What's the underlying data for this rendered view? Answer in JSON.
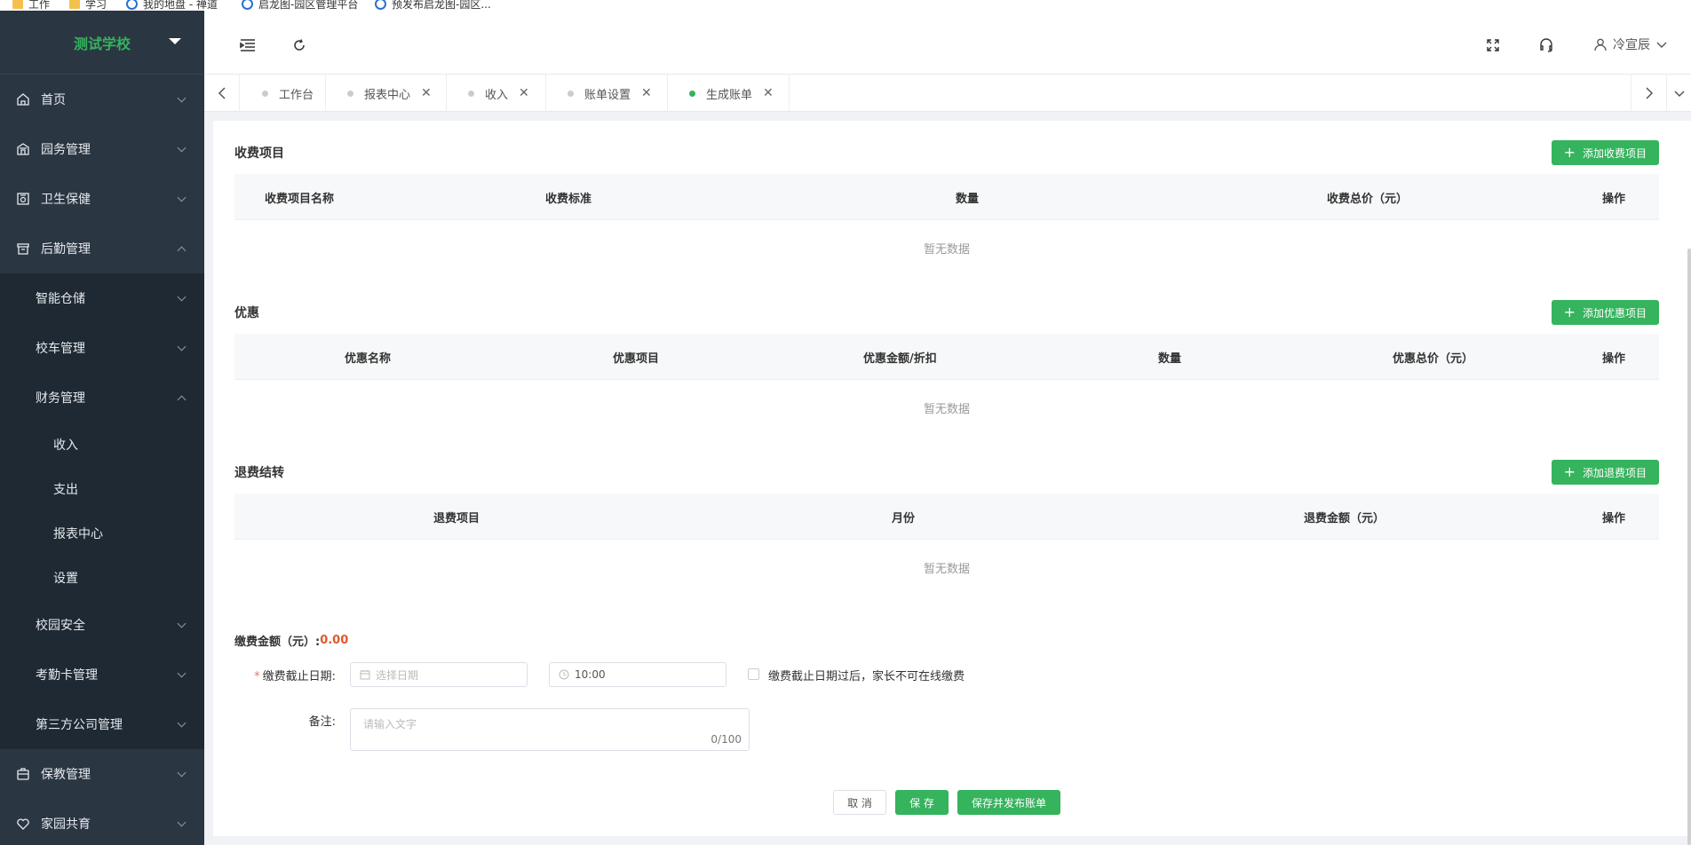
{
  "bookmarks": [
    {
      "label": "工作",
      "icon": "folder-icon"
    },
    {
      "label": "学习",
      "icon": "folder-icon"
    },
    {
      "label": "我的地盘 - 禅道",
      "icon": "site-icon"
    },
    {
      "label": "启龙图-园区管理平台",
      "icon": "site-icon"
    },
    {
      "label": "预发布启龙图-园区...",
      "icon": "site-icon"
    }
  ],
  "sidebar": {
    "school": "测试学校",
    "items": [
      {
        "label": "首页",
        "icon": "home-icon"
      },
      {
        "label": "园务管理",
        "icon": "building-icon"
      },
      {
        "label": "卫生保健",
        "icon": "health-icon"
      },
      {
        "label": "后勤管理",
        "icon": "logistics-icon"
      }
    ],
    "logistics_sub": [
      "智能仓储",
      "校车管理",
      "财务管理"
    ],
    "finance_sub": [
      "收入",
      "支出",
      "报表中心",
      "设置"
    ],
    "logistics_sub_more": [
      "校园安全",
      "考勤卡管理",
      "第三方公司管理"
    ],
    "items_bottom": [
      {
        "label": "保教管理",
        "icon": "education-icon"
      },
      {
        "label": "家园共育",
        "icon": "heart-icon"
      }
    ]
  },
  "topbar": {
    "user": "冷宣辰"
  },
  "tabs": [
    {
      "label": "工作台",
      "closable": false,
      "active": false
    },
    {
      "label": "报表中心",
      "closable": true,
      "active": false
    },
    {
      "label": "收入",
      "closable": true,
      "active": false
    },
    {
      "label": "账单设置",
      "closable": true,
      "active": false
    },
    {
      "label": "生成账单",
      "closable": true,
      "active": true
    }
  ],
  "fees": {
    "title": "收费项目",
    "add_label": "添加收费项目",
    "columns": [
      "收费项目名称",
      "收费标准",
      "数量",
      "收费总价（元）",
      "操作"
    ],
    "empty": "暂无数据"
  },
  "discounts": {
    "title": "优惠",
    "add_label": "添加优惠项目",
    "columns": [
      "优惠名称",
      "优惠项目",
      "优惠金额/折扣",
      "数量",
      "优惠总价（元）",
      "操作"
    ],
    "empty": "暂无数据"
  },
  "refunds": {
    "title": "退费结转",
    "add_label": "添加退费项目",
    "columns": [
      "退费项目",
      "月份",
      "退费金额（元）",
      "操作"
    ],
    "empty": "暂无数据"
  },
  "form": {
    "amount_label": "缴费金额（元）:",
    "amount_value": "0.00",
    "deadline_label": "缴费截止日期:",
    "date_placeholder": "选择日期",
    "time_value": "10:00",
    "checkbox_label": "缴费截止日期过后，家长不可在线缴费",
    "remark_label": "备注:",
    "remark_placeholder": "请输入文字",
    "remark_count": "0/100"
  },
  "actions": {
    "cancel": "取 消",
    "save": "保 存",
    "save_publish": "保存并发布账单"
  },
  "colors": {
    "accent": "#35b35d",
    "sidebar_bg": "#2b3643",
    "amount": "#e0582f"
  }
}
